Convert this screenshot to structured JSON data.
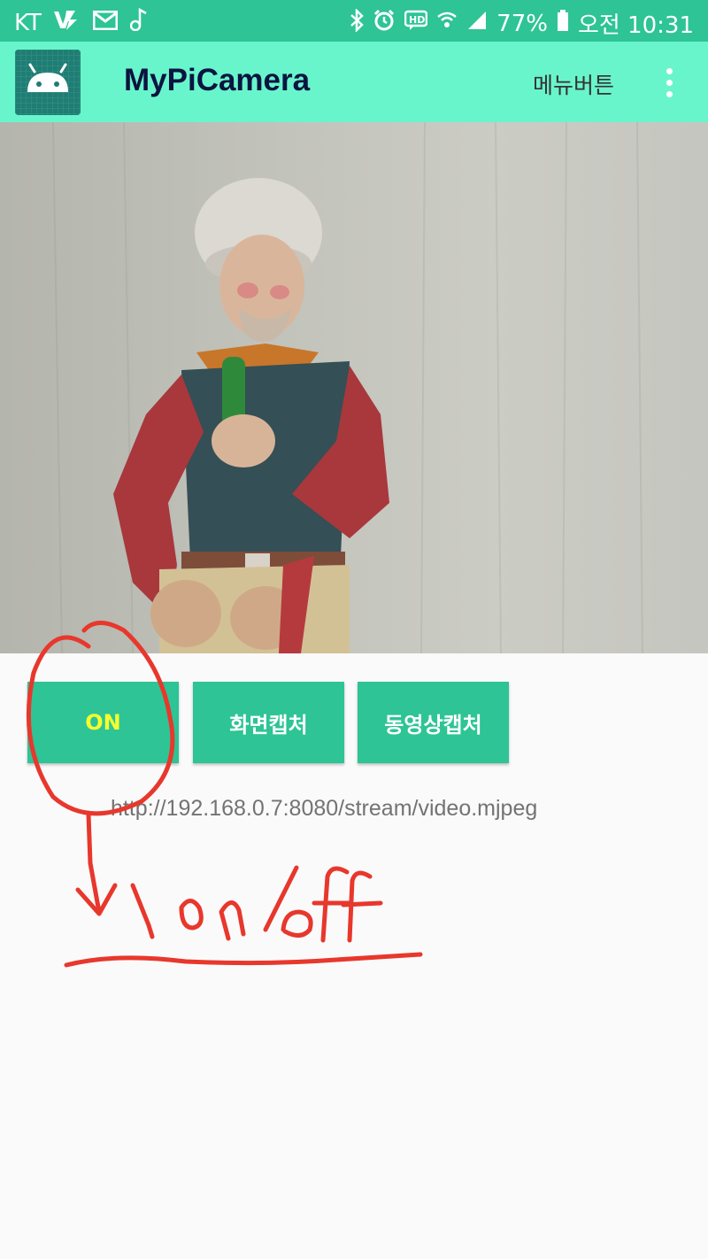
{
  "status_bar": {
    "carrier": "KT",
    "battery": "77%",
    "time": "오전 10:31",
    "left_icons": [
      "voicemail-icon",
      "mail-icon",
      "music-note-icon"
    ],
    "right_icons": [
      "bluetooth-icon",
      "alarm-icon",
      "hd-icon",
      "wifi-icon",
      "signal-icon",
      "battery-icon"
    ]
  },
  "app_bar": {
    "title": "MyPiCamera",
    "menu_button": "메뉴버튼",
    "icon": "android-icon",
    "overflow_icon": "more-vert-icon",
    "colors": {
      "bar": "#69f5cb",
      "status": "#2ec495"
    }
  },
  "camera_view": {
    "image": "camera-stream-figurine"
  },
  "controls": {
    "on_button": "ON",
    "capture_button": "화면캡처",
    "video_capture_button": "동영상캡처",
    "button_color": "#2ec495",
    "on_label_color": "#f5ff2e"
  },
  "stream_url": "http://192.168.0.7:8080/stream/video.mjpeg",
  "annotation": {
    "color": "#e8372c",
    "handwritten_text": "on / off"
  }
}
